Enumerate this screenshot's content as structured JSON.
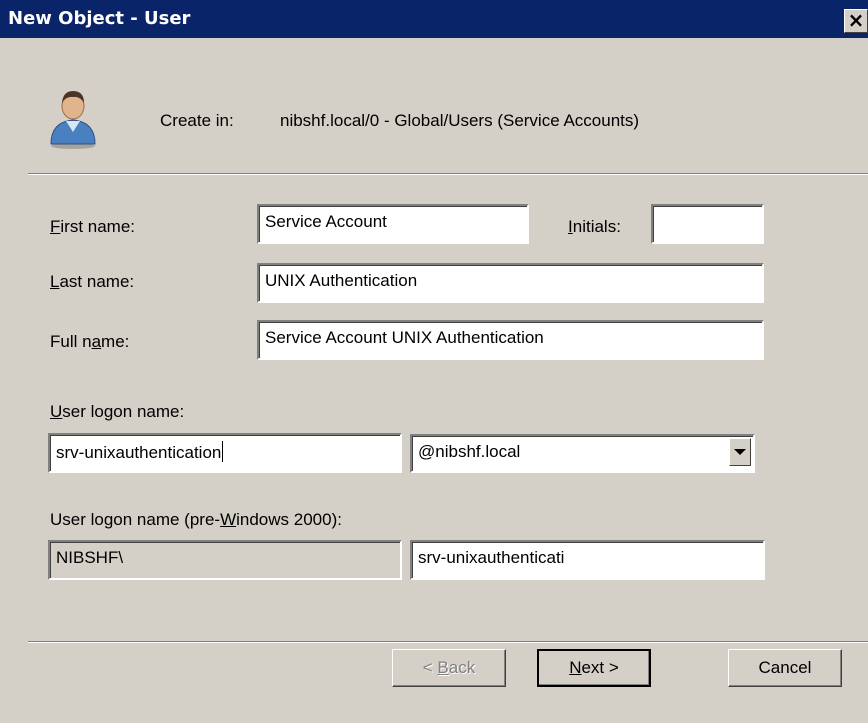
{
  "window": {
    "title": "New Object - User",
    "close_glyph": "×"
  },
  "create_in": {
    "label": "Create in:",
    "path": "nibshf.local/0 - Global/Users (Service Accounts)",
    "icon": "user-icon"
  },
  "fields": {
    "first_name": {
      "label_pre": "",
      "label_key": "F",
      "label_post": "irst name:",
      "value": "Service Account"
    },
    "initials": {
      "label_pre": "",
      "label_key": "I",
      "label_post": "nitials:",
      "value": ""
    },
    "last_name": {
      "label_pre": "",
      "label_key": "L",
      "label_post": "ast name:",
      "value": "UNIX Authentication"
    },
    "full_name": {
      "label_pre": "Full n",
      "label_key": "a",
      "label_post": "me:",
      "value": "Service Account UNIX Authentication"
    },
    "logon_name": {
      "label_pre": "",
      "label_key": "U",
      "label_post": "ser logon name:",
      "value": "srv-unixauthentication"
    },
    "domain_suffix": {
      "value": "@nibshf.local"
    },
    "pre_win2000": {
      "label_pre": "User logon name (pre-",
      "label_key": "W",
      "label_post": "indows 2000):",
      "domain": "NIBSHF\\",
      "value": "srv-unixauthenticati"
    }
  },
  "buttons": {
    "back": {
      "pre": "< ",
      "key": "B",
      "post": "ack"
    },
    "next": {
      "pre": "",
      "key": "N",
      "post": "ext >"
    },
    "cancel": {
      "label": "Cancel"
    }
  }
}
